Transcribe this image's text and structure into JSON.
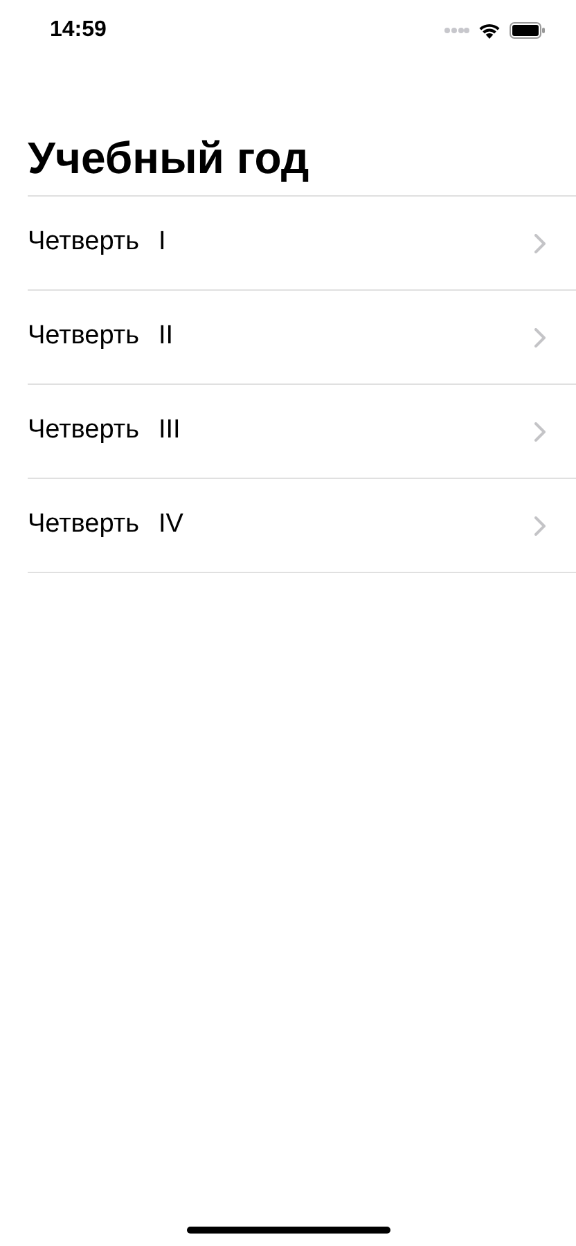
{
  "status_bar": {
    "time": "14:59"
  },
  "title": "Учебный год",
  "items": [
    {
      "label": "Четверть",
      "numeral": "I"
    },
    {
      "label": "Четверть",
      "numeral": "II"
    },
    {
      "label": "Четверть",
      "numeral": "III"
    },
    {
      "label": "Четверть",
      "numeral": "IV"
    }
  ]
}
